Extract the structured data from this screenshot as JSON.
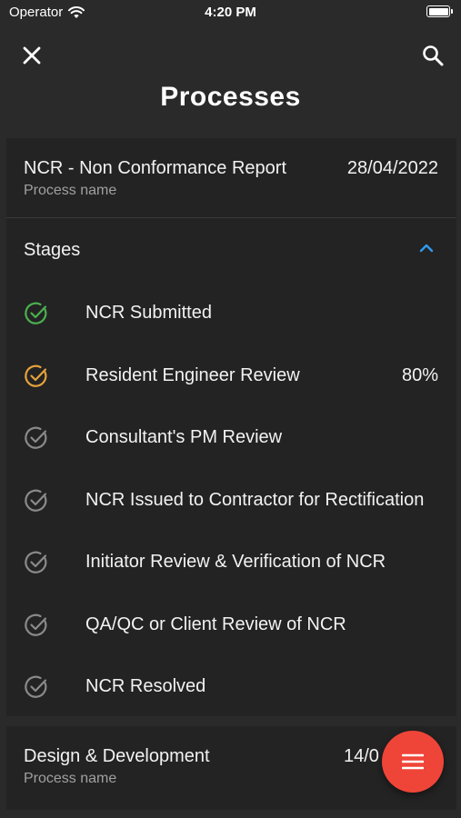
{
  "status_bar": {
    "carrier": "Operator",
    "time": "4:20 PM"
  },
  "header": {
    "title": "Processes"
  },
  "processes": [
    {
      "name": "NCR - Non Conformance Report",
      "subtitle": "Process name",
      "date": "28/04/2022",
      "stages_label": "Stages",
      "stages": [
        {
          "label": "NCR Submitted",
          "status": "complete",
          "color": "#4caf50",
          "percent": ""
        },
        {
          "label": "Resident Engineer Review",
          "status": "in-progress",
          "color": "#e6a23c",
          "percent": "80%"
        },
        {
          "label": "Consultant's PM Review",
          "status": "pending",
          "color": "#8a8a8a",
          "percent": ""
        },
        {
          "label": "NCR Issued to Contractor for Rectification",
          "status": "pending",
          "color": "#8a8a8a",
          "percent": ""
        },
        {
          "label": "Initiator Review & Verification of NCR",
          "status": "pending",
          "color": "#8a8a8a",
          "percent": ""
        },
        {
          "label": "QA/QC or Client Review of NCR",
          "status": "pending",
          "color": "#8a8a8a",
          "percent": ""
        },
        {
          "label": "NCR Resolved",
          "status": "pending",
          "color": "#8a8a8a",
          "percent": ""
        }
      ]
    },
    {
      "name": "Design & Development",
      "subtitle": "Process name",
      "date": "14/0"
    }
  ],
  "colors": {
    "accent": "#2f9bf0",
    "fab": "#ef4538",
    "card": "#232323",
    "background": "#2a2a2a"
  },
  "icons": {
    "close": "close-icon",
    "search": "search-icon",
    "collapse": "chevron-up-icon",
    "menu": "menu-icon",
    "stage": "check-circle-icon"
  }
}
